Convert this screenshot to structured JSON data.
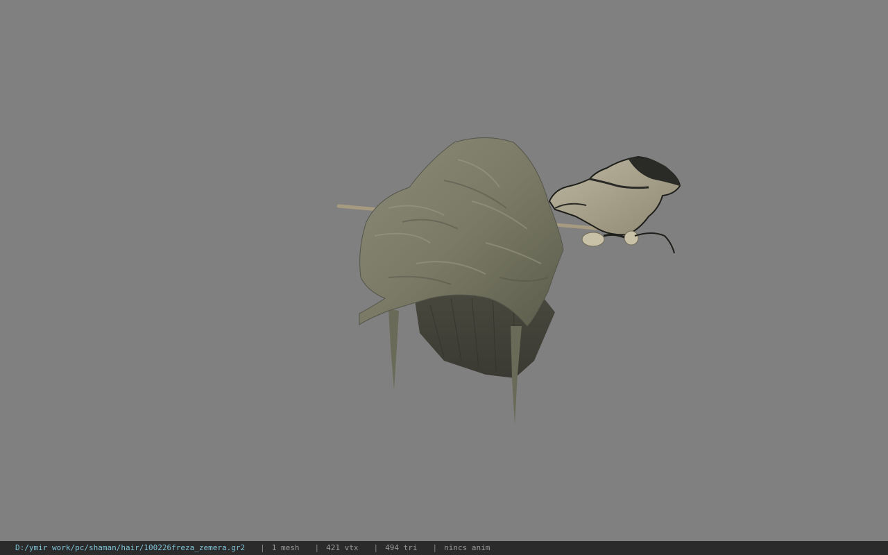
{
  "viewer": {
    "background_color": "#808080",
    "model_icon": "hair-model-icon"
  },
  "status": {
    "file_path": "D:/ymir work/pc/shaman/hair/100226freza_zemera.gr2",
    "separator": "|",
    "mesh_count": "1 mesh",
    "vertex_count": "421 vtx",
    "triangle_count": "494 tri",
    "animation": "nincs anim"
  }
}
